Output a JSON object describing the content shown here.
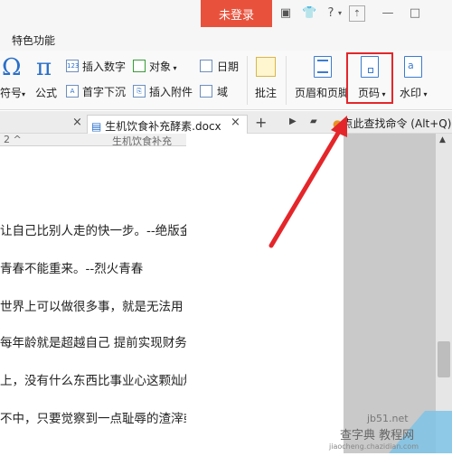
{
  "titlebar": {
    "login_label": "未登录",
    "help_label": "?",
    "minimize": "—",
    "maximize": "□"
  },
  "menubar": {
    "tab_label": "特色功能"
  },
  "ribbon": {
    "symbol_label": "符号",
    "formula_label": "公式",
    "insert_number": "插入数字",
    "object_label": "对象",
    "date_label": "日期",
    "drop_cap": "首字下沉",
    "insert_attachment": "插入附件",
    "field_label": "域",
    "comment_label": "批注",
    "header_footer": "页眉和页脚",
    "page_number": "页码",
    "watermark_label": "水印",
    "number_icon_text": "123"
  },
  "tabs": {
    "doc_tab": "生机饮食补充酵素.docx",
    "search_hint": "点此查找命令 (Alt+Q)",
    "sub_tab_1": "2 ^",
    "sub_tab_2": "生机饮食补充"
  },
  "document": {
    "lines": [
      "让自己比别人走的快一步。--绝版金",
      "青春不能重来。--烈火青春",
      "世界上可以做很多事，就是无法用",
      "每年龄就是超越自己 提前实现财务",
      "上，没有什么东西比事业心这颗灿烂",
      "不中，只要觉察到一点耻辱的渣滓或"
    ]
  },
  "watermark": {
    "line1": "查字典 教程网",
    "line2": "jiaocheng.chazidian.com",
    "site": "jb51.net"
  },
  "colors": {
    "login_bg": "#e8523c",
    "highlight": "#e4262a",
    "icon_blue": "#2a6fc9"
  }
}
